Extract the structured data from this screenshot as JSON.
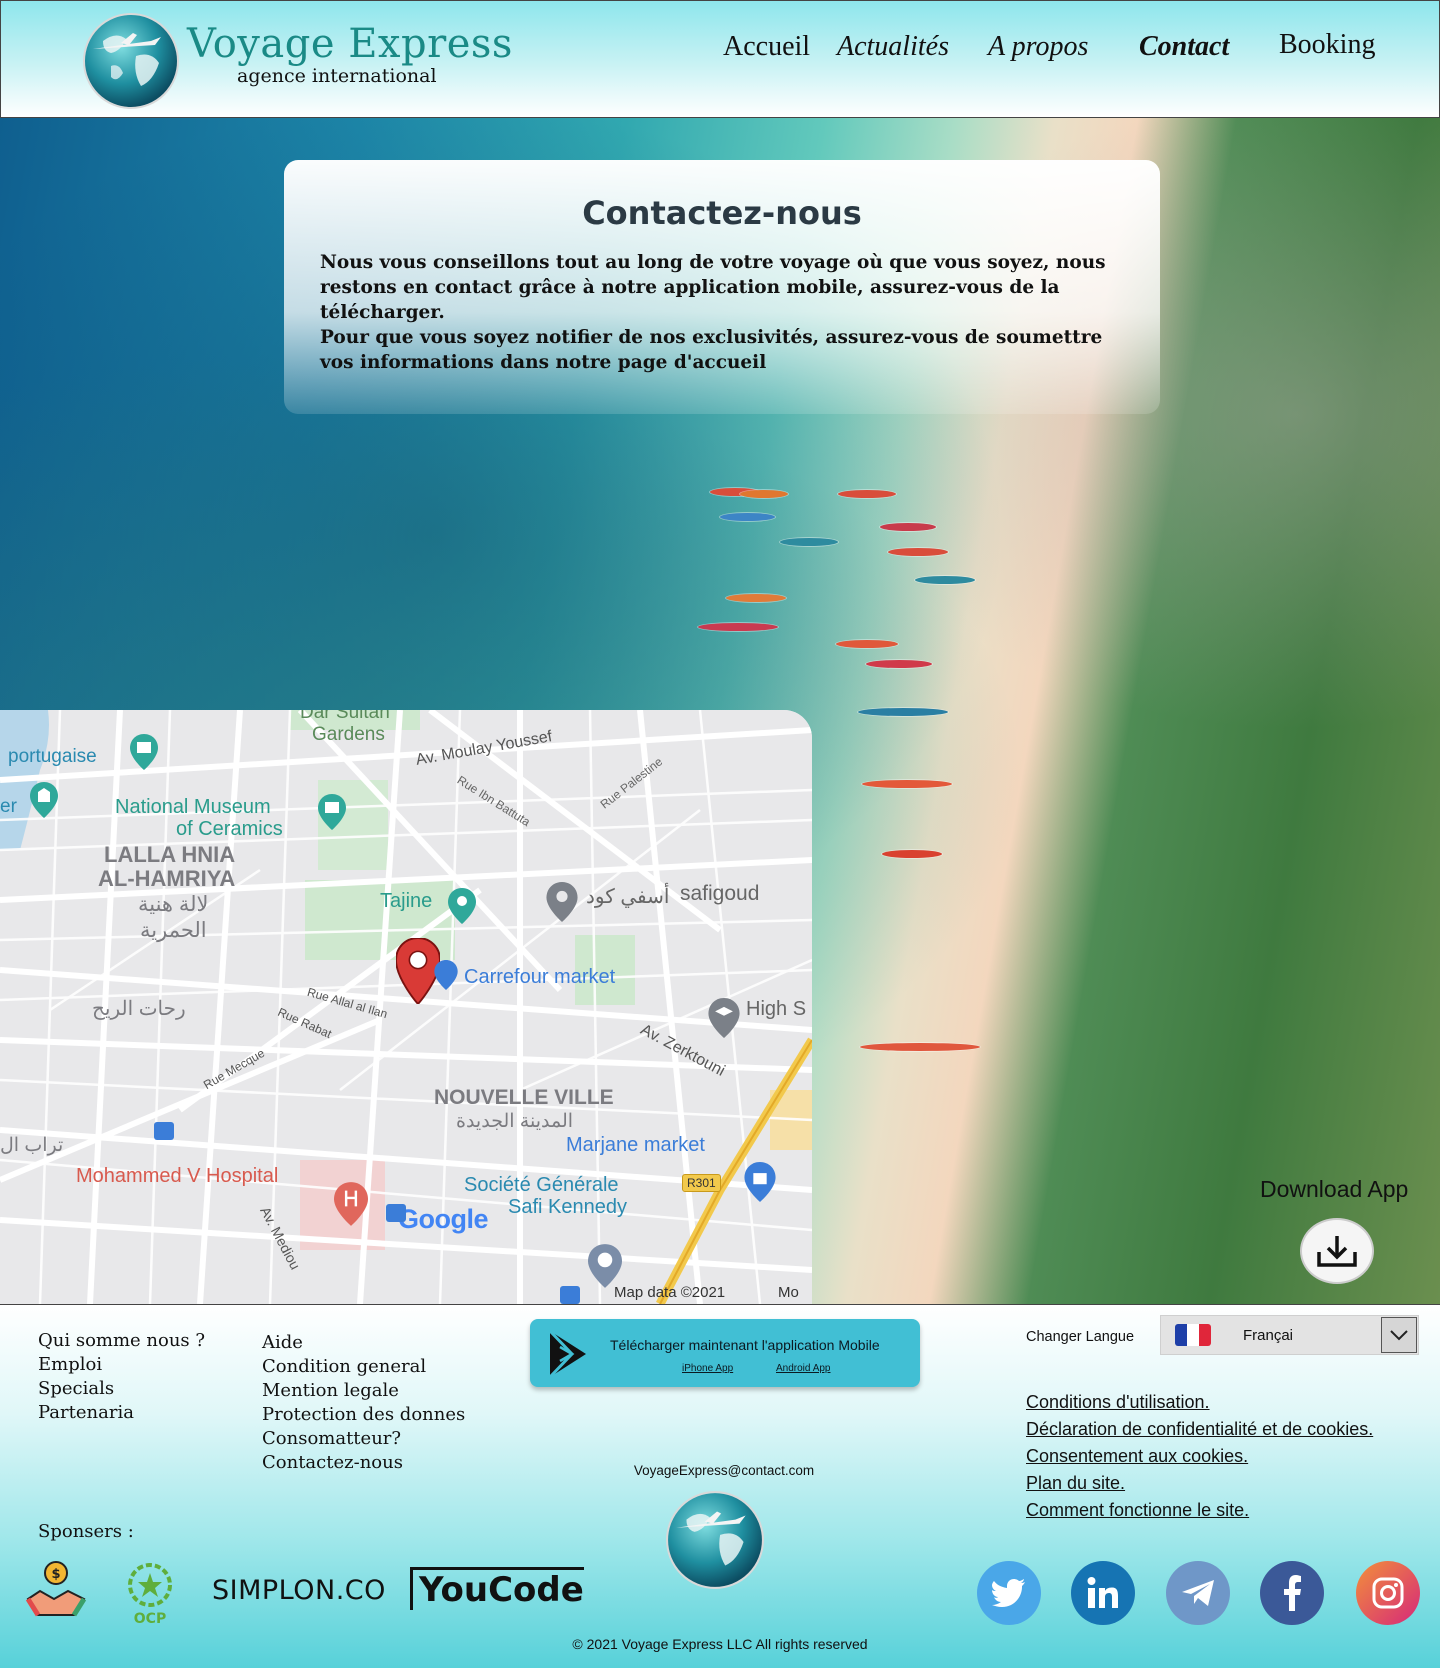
{
  "header": {
    "brand_title": "Voyage Express",
    "brand_subtitle": "agence international",
    "nav": [
      "Accueil",
      "Actualités",
      "A propos",
      "Contact",
      "Booking"
    ]
  },
  "contact": {
    "title": "Contactez-nous",
    "paragraph_1": "Nous vous conseillons tout au long de votre voyage où que vous soyez, nous restons en contact grâce à notre application mobile, assurez-vous de la télécharger.",
    "paragraph_2": "Pour que vous soyez notifier de nos exclusivités, assurez-vous de soumettre vos informations dans notre page d'accueil"
  },
  "map": {
    "labels": {
      "dar_sultan": "Dar Sultan",
      "gardens": "Gardens",
      "portugaise": "portugaise",
      "moulay": "Av. Moulay Youssef",
      "ibn_battuta": "Rue Ibn Battuta",
      "palestine": "Rue Palestine",
      "museum_1": "National Museum",
      "museum_2": "of Ceramics",
      "lalla_1": "LALLA HNIA",
      "lalla_2": "AL-HAMRIYA",
      "lalla_ar_1": "لالة هنية",
      "lalla_ar_2": "الحمرية",
      "tajine": "Tajine",
      "safigoud": "safigoud",
      "safigoud_ar": "أسفي كود",
      "carrefour": "Carrefour market",
      "rue_allal": "Rue Allal al Ilan",
      "rue_rabat": "Rue Rabat",
      "rihat_ar": "رحات الريح",
      "high": "High S",
      "zerktouni": "Av. Zerktouni",
      "mecque": "Rue Mecque",
      "nouvelle_ville": "NOUVELLE VILLE",
      "nouvelle_ville_ar": "المدينة الجديدة",
      "trab_ar": "تراب ال",
      "marjane": "Marjane market",
      "hospital": "Mohammed V Hospital",
      "societe_1": "Société Générale",
      "societe_2": "Safi Kennedy",
      "r301": "R301",
      "google": "Google",
      "map_data": "Map data ©2021",
      "mo": "Mo",
      "medio": "Av. Mediou",
      "er": "er"
    }
  },
  "download": {
    "label": "Download App"
  },
  "footer": {
    "col1": [
      "Qui somme nous ?",
      "Emploi",
      "Specials",
      "Partenaria"
    ],
    "col2": [
      "Aide",
      "Condition general",
      "Mention legale",
      "Protection des donnes",
      "Consomatteur?",
      "Contactez-nous"
    ],
    "app_banner": {
      "title": "Télécharger maintenant l'application Mobile",
      "iphone": "iPhone App",
      "android": "Android App"
    },
    "email": "VoyageExpress@contact.com",
    "language": {
      "label": "Changer Langue",
      "value": "Françai"
    },
    "legal": [
      "Conditions d'utilisation. ",
      "Déclaration de confidentialité et de cookies. ",
      "Consentement aux cookies. ",
      "Plan du site. ",
      "Comment fonctionne le site."
    ],
    "sponsors_label": "Sponsers :",
    "sponsors": {
      "ocp": "OCP",
      "simplon": "SIMPLON.CO",
      "youcode": "YouCode"
    },
    "social": [
      "twitter",
      "linkedin",
      "telegram",
      "facebook",
      "instagram"
    ],
    "copyright": "© 2021 Voyage Express LLC All rights reserved"
  },
  "colors": {
    "brand_teal": "#1a8a86",
    "app_banner": "#41bfd4",
    "twitter": "#4aa7e8",
    "linkedin": "#1674b3",
    "telegram": "#6f97c8",
    "facebook": "#3b5998",
    "instagram_start": "#f2903a",
    "instagram_end": "#d6287a"
  }
}
